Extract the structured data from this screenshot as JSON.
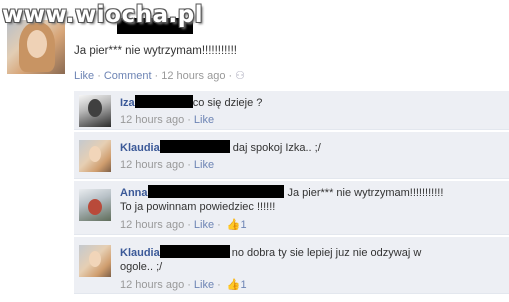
{
  "watermark": "www.wiocha.pl",
  "status": {
    "text": "Ja pier*** nie wytrzymam!!!!!!!!!!!",
    "like": "Like",
    "comment": "Comment",
    "time": "12 hours ago",
    "privacy_icon": "friends-icon"
  },
  "comments": [
    {
      "name": "Iza",
      "text": "co się dzieje ?",
      "time": "12 hours ago",
      "like": "Like",
      "likes": ""
    },
    {
      "name": "Klaudia",
      "text": "daj spokoj Izka.. ;/",
      "time": "12 hours ago",
      "like": "Like",
      "likes": ""
    },
    {
      "name": "Anna",
      "text": "Ja pier*** nie wytrzymam!!!!!!!!!!!",
      "text2": "To ja powinnam powiedziec !!!!!!",
      "time": "12 hours ago",
      "like": "Like",
      "likes": "1"
    },
    {
      "name": "Klaudia",
      "text": "no dobra ty sie lepiej juz nie odzywaj w",
      "text2": "ogole.. ;/",
      "time": "12 hours ago",
      "like": "Like",
      "likes": "1"
    }
  ],
  "colors": {
    "link": "#3b5998",
    "meta_link": "#6d84b4",
    "comment_bg": "#edeff4"
  }
}
